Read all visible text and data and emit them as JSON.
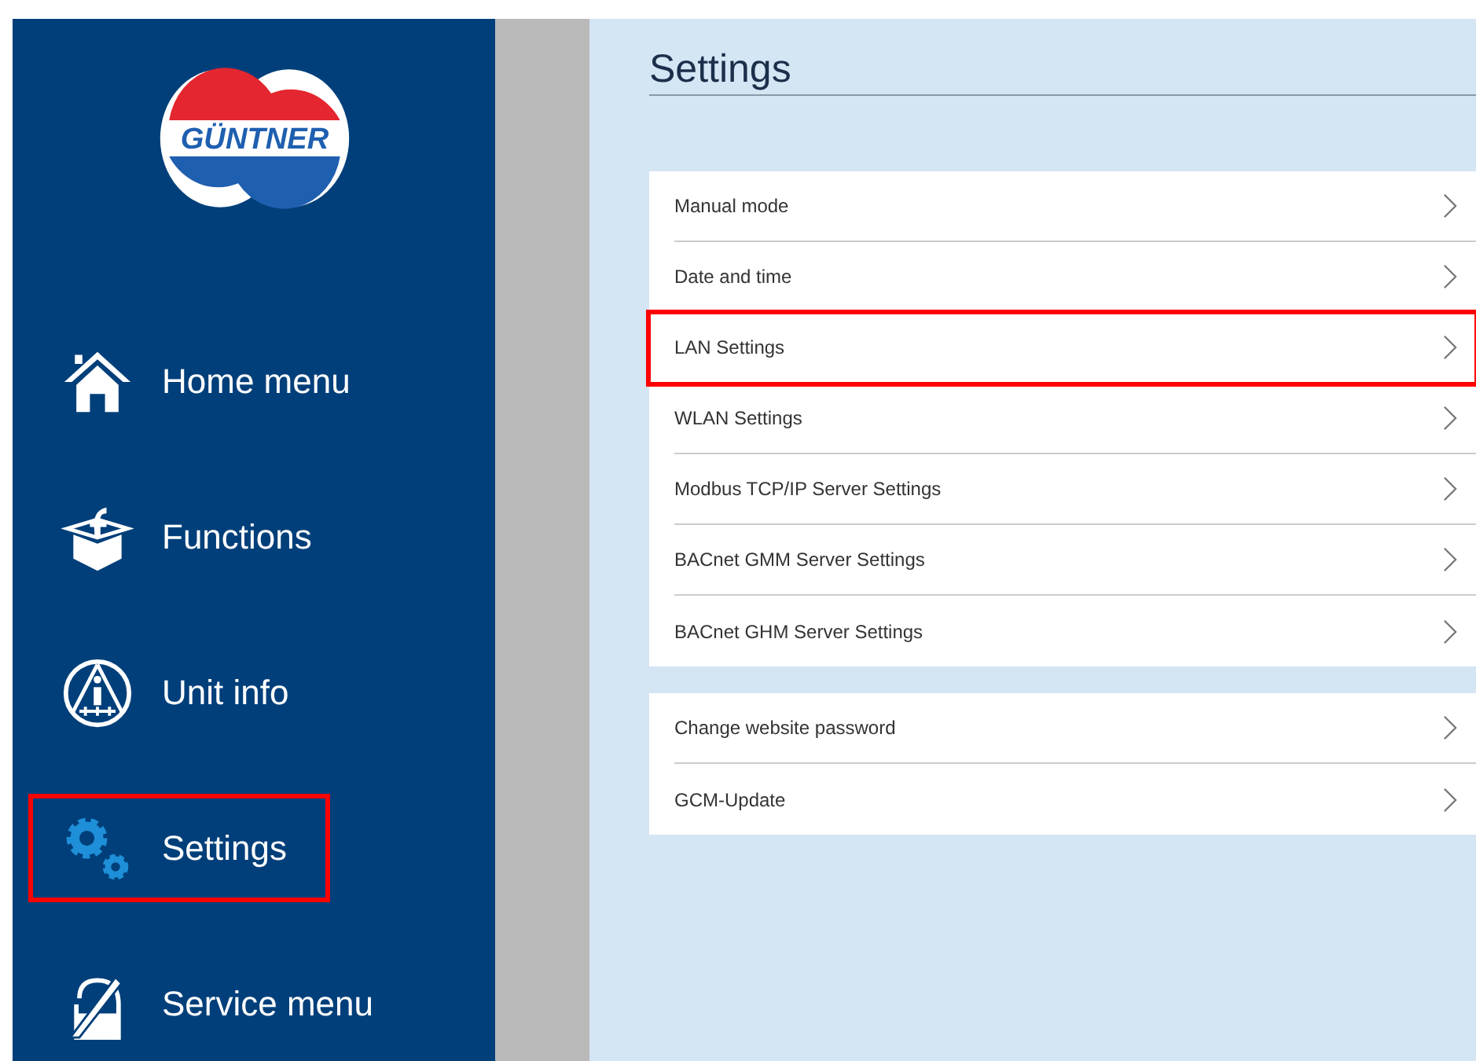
{
  "logo": {
    "text": "GÜNTNER"
  },
  "sidebar": {
    "items": [
      {
        "label": "Home menu",
        "highlighted": false
      },
      {
        "label": "Functions",
        "highlighted": false
      },
      {
        "label": "Unit info",
        "highlighted": false
      },
      {
        "label": "Settings",
        "highlighted": true
      },
      {
        "label": "Service menu",
        "highlighted": false
      }
    ]
  },
  "title": "Settings",
  "groups": [
    [
      {
        "label": "Manual mode",
        "highlighted": false
      },
      {
        "label": "Date and time",
        "highlighted": false
      },
      {
        "label": "LAN Settings",
        "highlighted": true
      },
      {
        "label": "WLAN Settings",
        "highlighted": false
      },
      {
        "label": "Modbus TCP/IP Server Settings",
        "highlighted": false
      },
      {
        "label": "BACnet GMM Server Settings",
        "highlighted": false
      },
      {
        "label": "BACnet GHM Server Settings",
        "highlighted": false
      }
    ],
    [
      {
        "label": "Change website password",
        "highlighted": false
      },
      {
        "label": "GCM-Update",
        "highlighted": false
      }
    ]
  ]
}
